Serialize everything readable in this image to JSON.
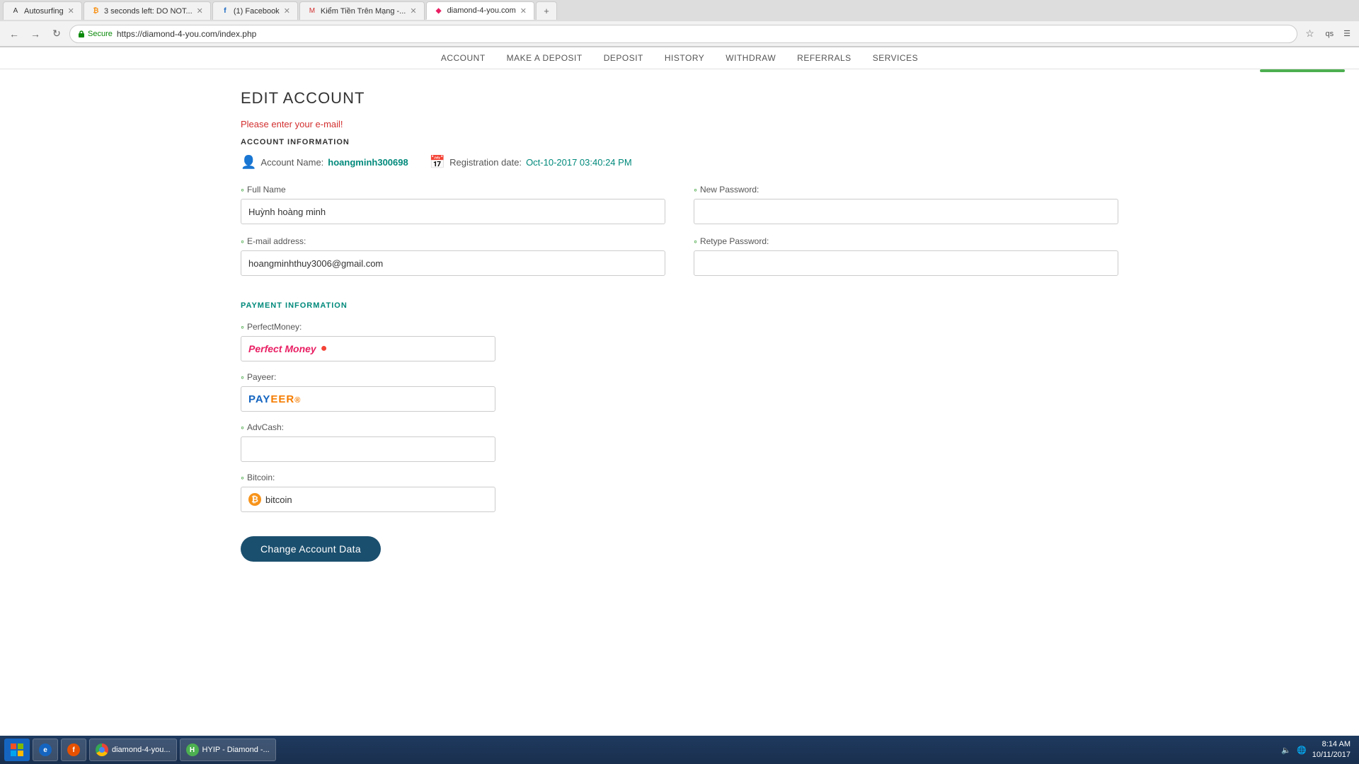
{
  "browser": {
    "tabs": [
      {
        "label": "Autosurfing",
        "favicon": "A",
        "active": false,
        "id": "autosurfing"
      },
      {
        "label": "3 seconds left: DO NOT...",
        "favicon": "B",
        "active": false,
        "id": "btc"
      },
      {
        "label": "(1) Facebook",
        "favicon": "f",
        "active": false,
        "id": "facebook"
      },
      {
        "label": "Kiểm Tiền Trên Mạng -...",
        "favicon": "M",
        "active": false,
        "id": "kiemtien"
      },
      {
        "label": "diamond-4-you.com",
        "favicon": "D",
        "active": true,
        "id": "diamond"
      }
    ],
    "secure_label": "Secure",
    "url": "https://diamond-4-you.com/index.php"
  },
  "nav": {
    "items": [
      "ACCOUNT",
      "MAKE A DEPOSIT",
      "DEPOSIT",
      "HISTORY",
      "WITHDRAW",
      "REFERRALS",
      "SERVICES"
    ]
  },
  "page": {
    "title": "EDIT ACCOUNT",
    "error_message": "Please enter your e-mail!",
    "account_info": {
      "label_name": "Account Name:",
      "name_value": "hoangminh300698",
      "label_reg": "Registration date:",
      "reg_value": "Oct-10-2017 03:40:24 PM"
    },
    "form": {
      "full_name_label": "Full Name",
      "full_name_value": "Huỳnh hoàng minh",
      "email_label": "E-mail address:",
      "email_value": "hoangminhthuy3006@gmail.com",
      "new_password_label": "New Password:",
      "new_password_value": "",
      "retype_password_label": "Retype Password:",
      "retype_password_value": ""
    },
    "payment": {
      "section_label": "PAYMENT INFORMATION",
      "perfect_money_label": "PerfectMoney:",
      "perfect_money_value": "Perfect Money",
      "payeer_label": "Payeer:",
      "payeer_value": "PAYEER",
      "advcash_label": "AdvCash:",
      "advcash_value": "",
      "bitcoin_label": "Bitcoin:",
      "bitcoin_value": "bitcoin"
    },
    "submit_label": "Change Account Data"
  },
  "taskbar": {
    "time": "8:14 AM",
    "date": "10/11/2017",
    "items": [
      {
        "label": "diamond-4-you...",
        "icon": "D"
      },
      {
        "label": "HYIP - Diamond -...",
        "icon": "H"
      }
    ]
  }
}
